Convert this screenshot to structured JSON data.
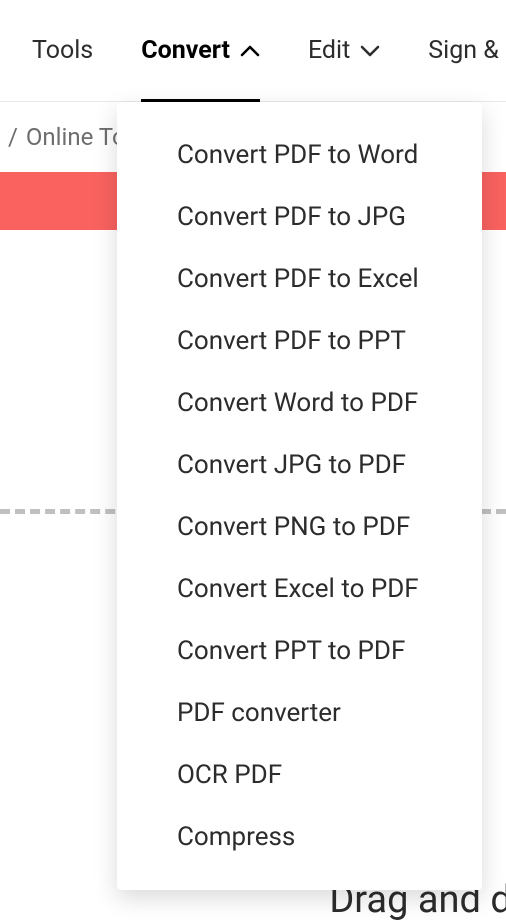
{
  "nav": {
    "tools": "Tools",
    "convert": "Convert",
    "edit": "Edit",
    "sign": "Sign & P"
  },
  "sub_bar": {
    "left_fragment": "/",
    "online_tools": "Online To"
  },
  "dropdown": {
    "items": [
      "Convert PDF to Word",
      "Convert PDF to JPG",
      "Convert PDF to Excel",
      "Convert PDF to PPT",
      "Convert Word to PDF",
      "Convert JPG to PDF",
      "Convert PNG to PDF",
      "Convert Excel to PDF",
      "Convert PPT to PDF",
      "PDF converter",
      "OCR PDF",
      "Compress"
    ]
  },
  "drag_text": "Drag and dro"
}
